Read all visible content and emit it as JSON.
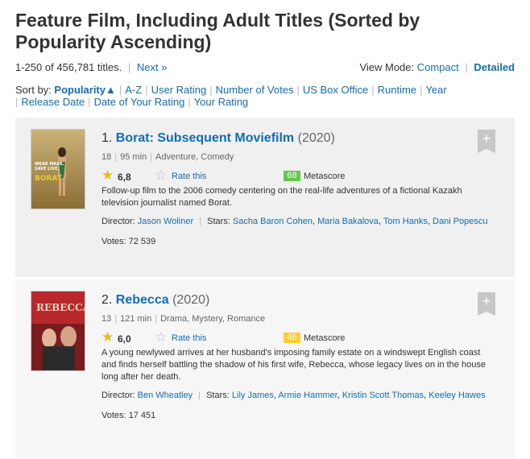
{
  "page": {
    "title": "Feature Film, Including Adult Titles (Sorted by Popularity Ascending)",
    "count_text": "1-250 of 456,781 titles.",
    "next_label": "Next »",
    "view_mode_label": "View Mode:",
    "view_compact": "Compact",
    "view_detailed": "Detailed"
  },
  "sort": {
    "label": "Sort by:",
    "options": [
      "Popularity▲",
      "A-Z",
      "User Rating",
      "Number of Votes",
      "US Box Office",
      "Runtime",
      "Year",
      "Release Date",
      "Date of Your Rating",
      "Your Rating"
    ]
  },
  "items": [
    {
      "num": "1.",
      "title": "Borat: Subsequent Moviefilm",
      "year": "(2020)",
      "cert": "18",
      "runtime": "95 min",
      "genre": "Adventure, Comedy",
      "rating": "6,8",
      "rate_label": "Rate this",
      "metascore": "68",
      "metascore_color": "#61c74f",
      "metascore_label": "Metascore",
      "description": "Follow-up film to the 2006 comedy centering on the real-life adventures of a fictional Kazakh television journalist named Borat.",
      "director_label": "Director:",
      "director": "Jason Woliner",
      "stars_label": "Stars:",
      "stars": [
        "Sacha Baron Cohen",
        "Maria Bakalova",
        "Tom Hanks",
        "Dani Popescu"
      ],
      "votes_label": "Votes:",
      "votes": "72 539",
      "poster_text": [
        "WEAR MASK.",
        "SAVE LIVE.",
        "BORAT"
      ]
    },
    {
      "num": "2.",
      "title": "Rebecca",
      "year": "(2020)",
      "cert": "13",
      "runtime": "121 min",
      "genre": "Drama, Mystery, Romance",
      "rating": "6,0",
      "rate_label": "Rate this",
      "metascore": "46",
      "metascore_color": "#fdcc33",
      "metascore_label": "Metascore",
      "description": "A young newlywed arrives at her husband's imposing family estate on a windswept English coast and finds herself battling the shadow of his first wife, Rebecca, whose legacy lives on in the house long after her death.",
      "director_label": "Director:",
      "director": "Ben Wheatley",
      "stars_label": "Stars:",
      "stars": [
        "Lily James",
        "Armie Hammer",
        "Kristin Scott Thomas",
        "Keeley Hawes"
      ],
      "votes_label": "Votes:",
      "votes": "17 451",
      "poster_text": [
        "REBECCA"
      ]
    }
  ]
}
